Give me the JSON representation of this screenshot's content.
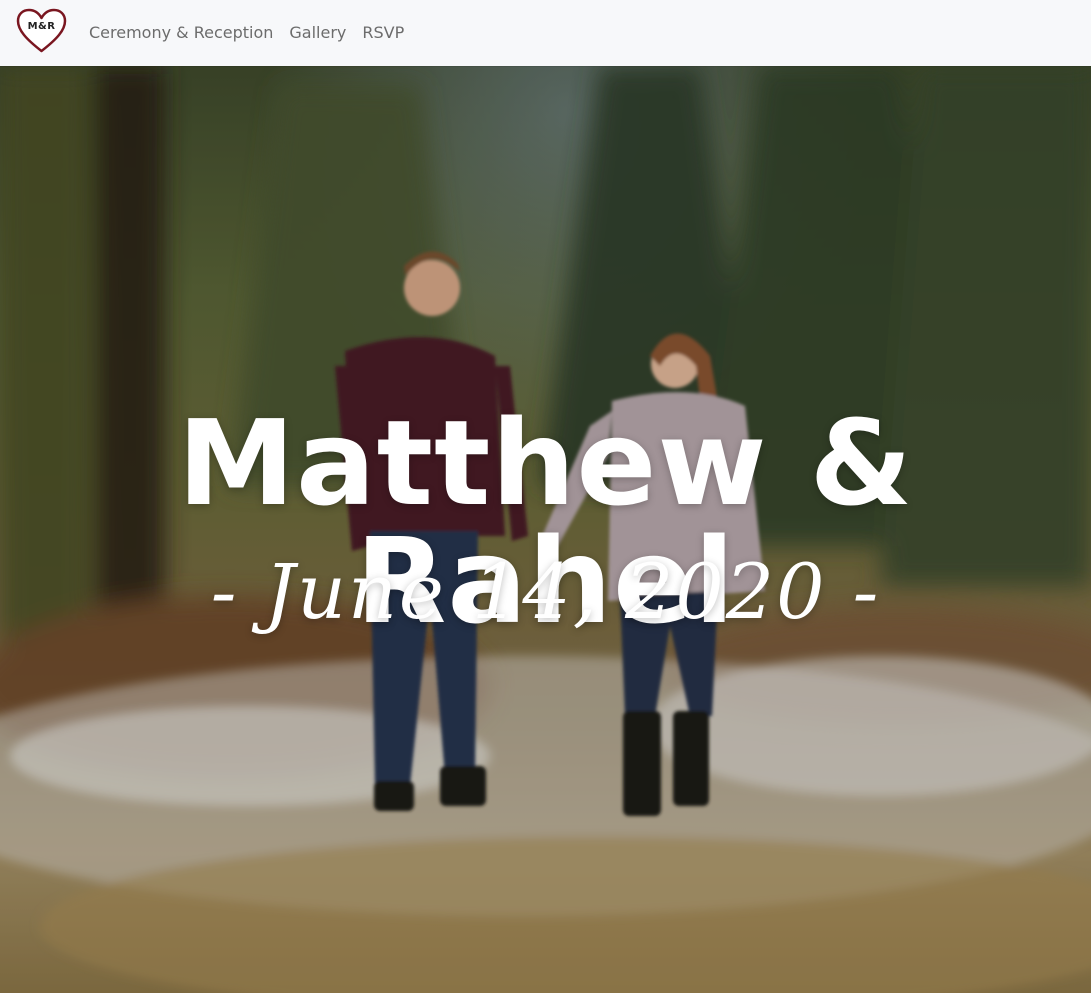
{
  "brand": {
    "logo_text": "M&R",
    "logo_icon": "heart-icon"
  },
  "nav": {
    "items": [
      {
        "label": "Ceremony & Reception"
      },
      {
        "label": "Gallery"
      },
      {
        "label": "RSVP"
      }
    ]
  },
  "hero": {
    "title": "Matthew & Rahel",
    "date": "- June 14, 2020 -"
  },
  "colors": {
    "navbar_bg": "#f7f8fa",
    "nav_text": "#6c6c6c",
    "heart_stroke": "#7a1620",
    "hero_text": "#ffffff"
  }
}
